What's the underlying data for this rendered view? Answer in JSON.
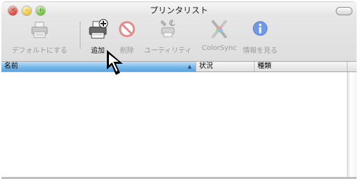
{
  "window": {
    "title": "プリンタリスト"
  },
  "titlebar": {
    "close_icon": "close-icon",
    "minimize_icon": "minimize-icon",
    "zoom_icon": "zoom-icon"
  },
  "toolbar": {
    "items": [
      {
        "label": "デフォルトにする",
        "icon": "printer-gray-icon",
        "enabled": false
      },
      {
        "label": "追加",
        "icon": "printer-add-icon",
        "enabled": true
      },
      {
        "label": "削除",
        "icon": "delete-circle-icon",
        "enabled": false
      },
      {
        "label": "ユーティリティ",
        "icon": "utility-icon",
        "enabled": false
      },
      {
        "label": "ColorSync",
        "icon": "colorsync-icon",
        "enabled": false
      },
      {
        "label": "情報を見る",
        "icon": "info-icon",
        "enabled": false
      }
    ]
  },
  "table": {
    "columns": [
      {
        "label": "名前",
        "sorted": true
      },
      {
        "label": "状況",
        "sorted": false
      },
      {
        "label": "種類",
        "sorted": false
      }
    ],
    "rows": []
  },
  "colors": {
    "sorted_header": "#79b8ea",
    "toolbar_bg": "#e1e1e1"
  }
}
